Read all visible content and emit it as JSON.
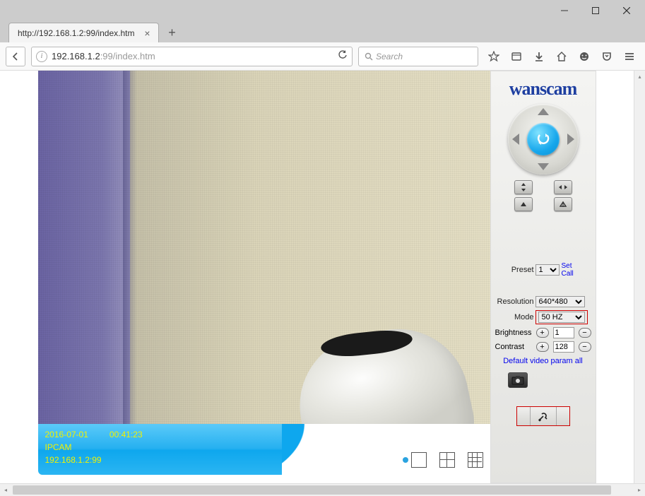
{
  "window": {
    "tab_title": "http://192.168.1.2:99/index.htm",
    "url_display_dark": "192.168.1.2",
    "url_display_faded": ":99/index.htm",
    "search_placeholder": "Search"
  },
  "osd": {
    "date": "2016-07-01",
    "time": "00:41:23",
    "name": "IPCAM",
    "address": "192.168.1.2:99"
  },
  "panel": {
    "brand": "wanscam",
    "preset_label": "Preset",
    "preset_value": "1",
    "preset_set": "Set",
    "preset_call": "Call",
    "resolution_label": "Resolution",
    "resolution_value": "640*480",
    "mode_label": "Mode",
    "mode_value": "50 HZ",
    "brightness_label": "Brightness",
    "brightness_value": "1",
    "contrast_label": "Contrast",
    "contrast_value": "128",
    "default_link": "Default video param all"
  }
}
